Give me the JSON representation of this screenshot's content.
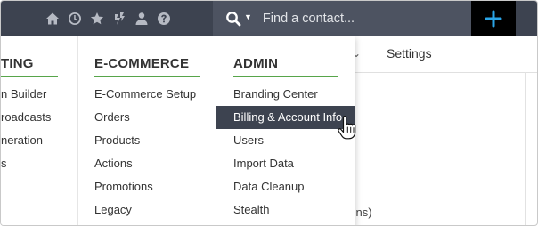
{
  "topbar": {
    "icons": [
      "home-icon",
      "clock-icon",
      "star-icon",
      "stack-icon",
      "person-icon",
      "help-icon"
    ],
    "search": {
      "placeholder": "Find a contact...",
      "value": ""
    },
    "add_icon": "plus-icon"
  },
  "background_page": {
    "settings_label": "Settings",
    "partial_text": "eens)"
  },
  "menu": {
    "marketing": {
      "heading": "TING",
      "items": [
        "n Builder",
        "roadcasts",
        "neration",
        "s"
      ]
    },
    "ecommerce": {
      "heading": "E-COMMERCE",
      "items": [
        "E-Commerce Setup",
        "Orders",
        "Products",
        "Actions",
        "Promotions",
        "Legacy"
      ]
    },
    "admin": {
      "heading": "ADMIN",
      "items": [
        "Branding Center",
        "Billing & Account Info",
        "Users",
        "Import Data",
        "Data Cleanup",
        "Stealth"
      ],
      "active_index": 1
    }
  },
  "colors": {
    "topbar": "#3d4350",
    "search_bg": "#4d5361",
    "accent_green": "#57a54a",
    "plus_blue": "#2aa4e6",
    "active_bg": "#3d4350"
  }
}
